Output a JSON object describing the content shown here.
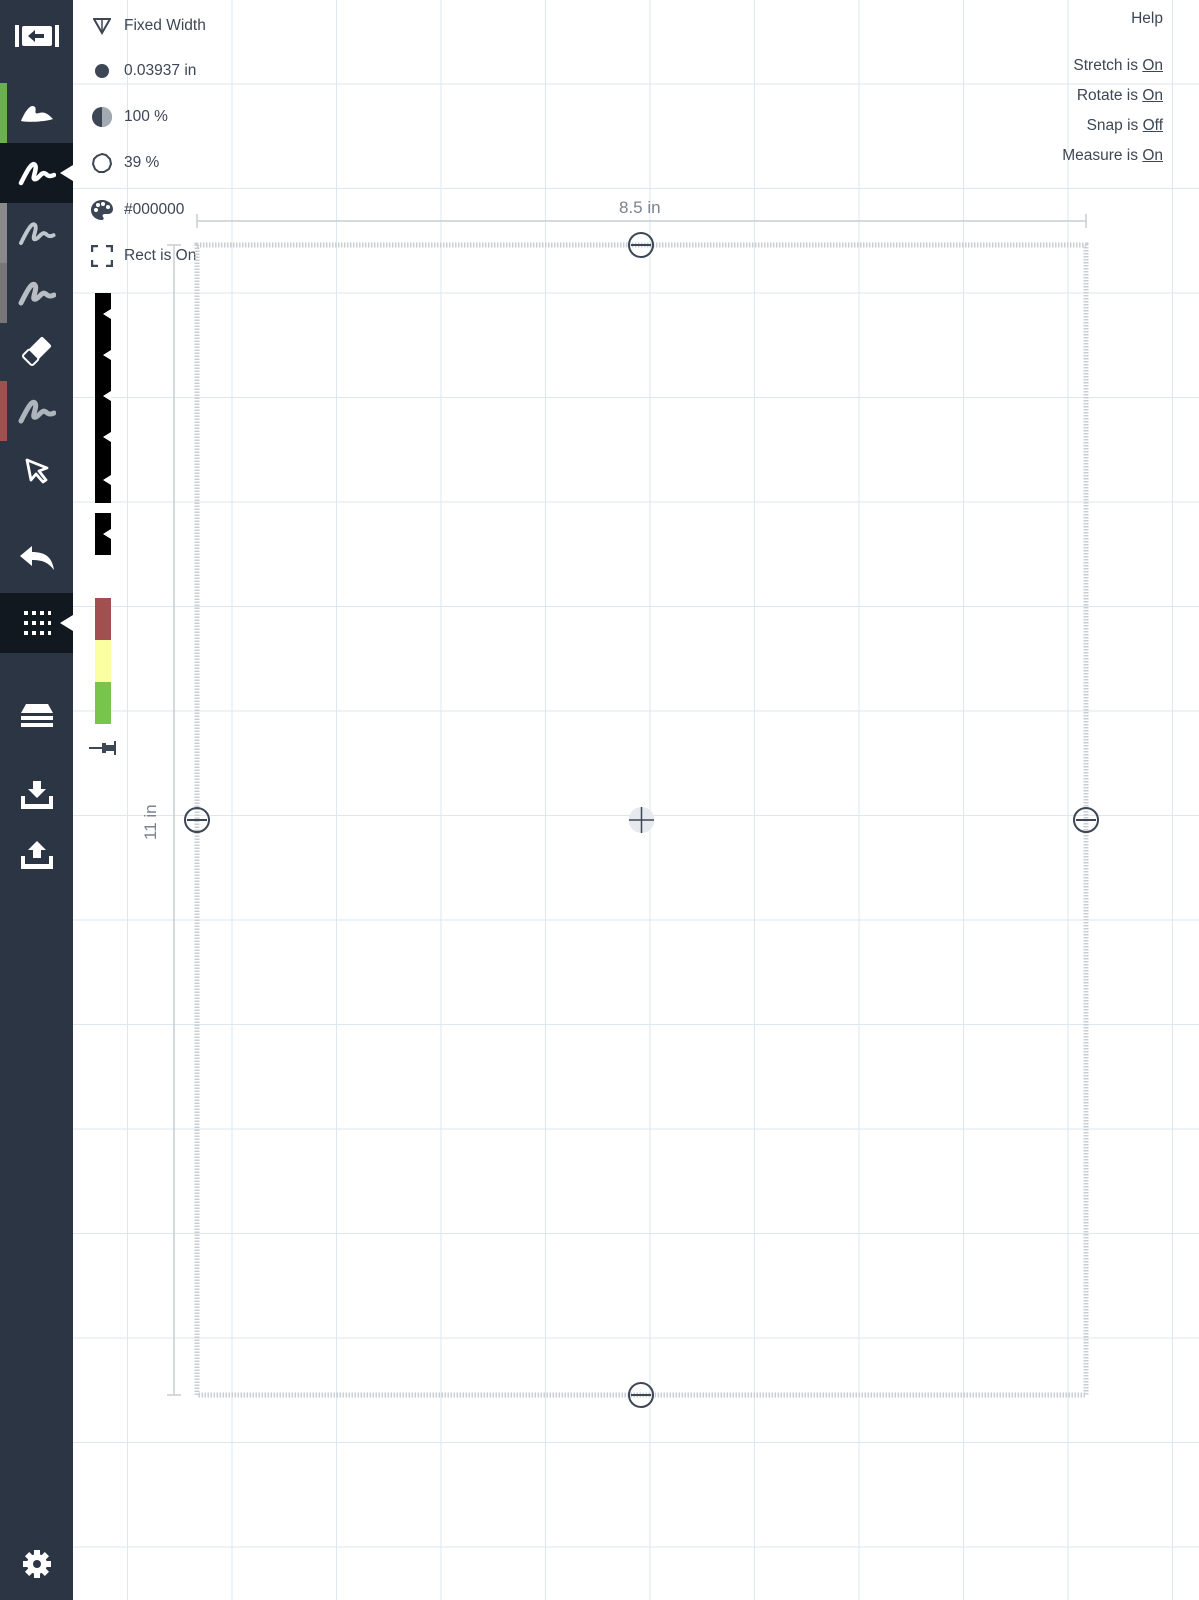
{
  "sidebar": {
    "tools": [
      {
        "name": "back-icon"
      },
      {
        "name": "brush-icon",
        "accent": "#6ab04c"
      },
      {
        "name": "pen-icon",
        "active": true
      },
      {
        "name": "pencil-icon",
        "accent": "#777777"
      },
      {
        "name": "marker-icon",
        "accent": "#777777"
      },
      {
        "name": "eraser-icon"
      },
      {
        "name": "highlighter-icon",
        "accent": "#a24f4f"
      },
      {
        "name": "select-icon"
      },
      {
        "name": "undo-icon"
      },
      {
        "name": "grid-icon",
        "active": true
      },
      {
        "name": "layers-icon"
      },
      {
        "name": "import-icon"
      },
      {
        "name": "export-icon"
      },
      {
        "name": "settings-icon"
      }
    ]
  },
  "properties": {
    "mode": "Fixed Width",
    "width": "0.03937 in",
    "opacity": "100 %",
    "smoothing": "39 %",
    "color": "#000000",
    "rect": "Rect is On"
  },
  "palette": {
    "swatches": [
      "#000000",
      "#000000",
      "#000000",
      "#000000",
      "#000000",
      "#000000",
      "#a24f4f",
      "#fbff9f",
      "#79c54b"
    ]
  },
  "toggles": {
    "help": "Help",
    "stretch": {
      "label": "Stretch is ",
      "value": "On"
    },
    "rotate": {
      "label": "Rotate is ",
      "value": "On"
    },
    "snap": {
      "label": "Snap is ",
      "value": "Off"
    },
    "measure": {
      "label": "Measure is ",
      "value": "On"
    }
  },
  "page": {
    "width_label": "8.5 in",
    "height_label": "11 in"
  },
  "colors": {
    "sidebar": "#2b3544",
    "sidebar_active": "#121820",
    "grid": "#dce7ef",
    "text": "#3d4654"
  }
}
